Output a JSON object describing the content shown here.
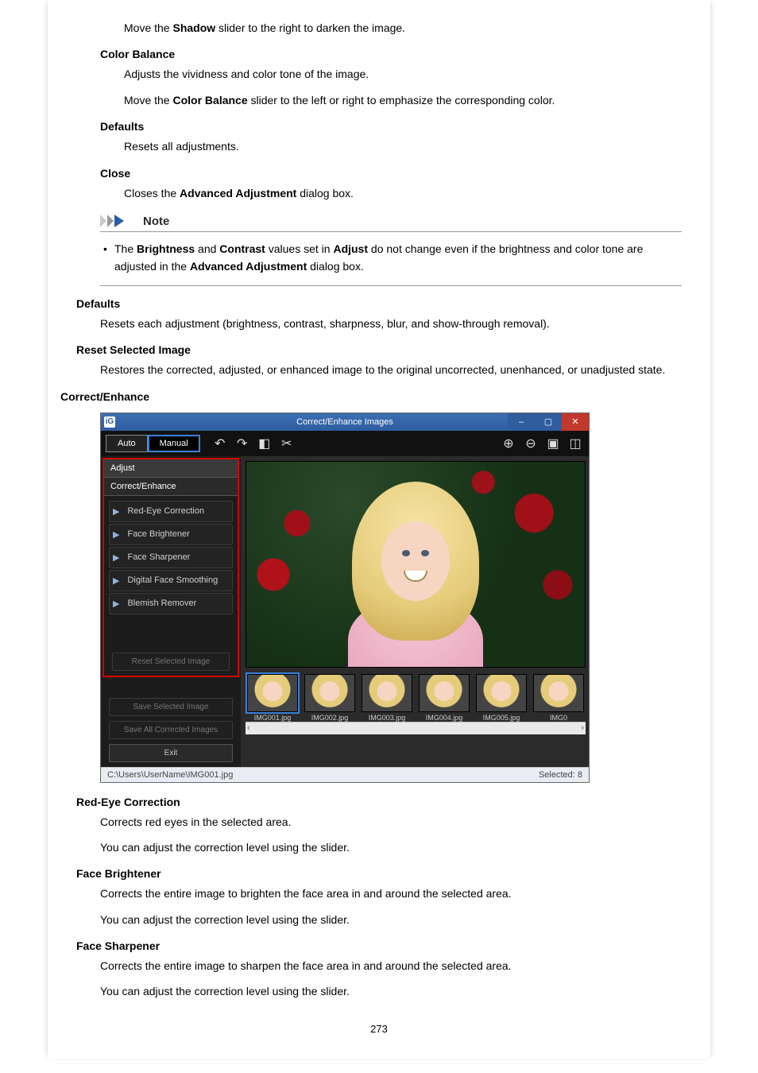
{
  "body": {
    "shadow_desc": "Move the <b>Shadow</b> slider to the right to darken the image.",
    "color_balance_t": "Color Balance",
    "color_balance_1": "Adjusts the vividness and color tone of the image.",
    "color_balance_2": "Move the <b>Color Balance</b> slider to the left or right to emphasize the corresponding color.",
    "defaults_inner_t": "Defaults",
    "defaults_inner_d": "Resets all adjustments.",
    "close_t": "Close",
    "close_d": "Closes the <b>Advanced Adjustment</b> dialog box.",
    "note_title": "Note",
    "note_text": "The <b>Brightness</b> and <b>Contrast</b> values set in <b>Adjust</b> do not change even if the brightness and color tone are adjusted in the <b>Advanced Adjustment</b> dialog box.",
    "defaults_outer_t": "Defaults",
    "defaults_outer_d": "Resets each adjustment (brightness, contrast, sharpness, blur, and show-through removal).",
    "reset_sel_t": "Reset Selected Image",
    "reset_sel_d": "Restores the corrected, adjusted, or enhanced image to the original uncorrected, unenhanced, or unadjusted state.",
    "section_t": "Correct/Enhance",
    "redeye_t": "Red-Eye Correction",
    "redeye_1": "Corrects red eyes in the selected area.",
    "redeye_2": "You can adjust the correction level using the slider.",
    "facebright_t": "Face Brightener",
    "facebright_1": "Corrects the entire image to brighten the face area in and around the selected area.",
    "facebright_2": "You can adjust the correction level using the slider.",
    "facesharp_t": "Face Sharpener",
    "facesharp_1": "Corrects the entire image to sharpen the face area in and around the selected area.",
    "facesharp_2": "You can adjust the correction level using the slider."
  },
  "app": {
    "title": "Correct/Enhance Images",
    "tab_auto": "Auto",
    "tab_manual": "Manual",
    "side_adjust": "Adjust",
    "side_correct": "Correct/Enhance",
    "items": {
      "redeye": "Red-Eye Correction",
      "facebright": "Face Brightener",
      "facesharp": "Face Sharpener",
      "digital": "Digital Face Smoothing",
      "blemish": "Blemish Remover"
    },
    "btn_reset_sel": "Reset Selected Image",
    "btn_save_sel": "Save Selected Image",
    "btn_save_all": "Save All Corrected Images",
    "btn_exit": "Exit",
    "thumbs": [
      "IMG001.jpg",
      "IMG002.jpg",
      "IMG003.jpg",
      "IMG004.jpg",
      "IMG005.jpg",
      "IMG0"
    ],
    "status_path": "C:\\Users\\UserName\\IMG001.jpg",
    "status_sel": "Selected: 8"
  },
  "page_num": "273"
}
